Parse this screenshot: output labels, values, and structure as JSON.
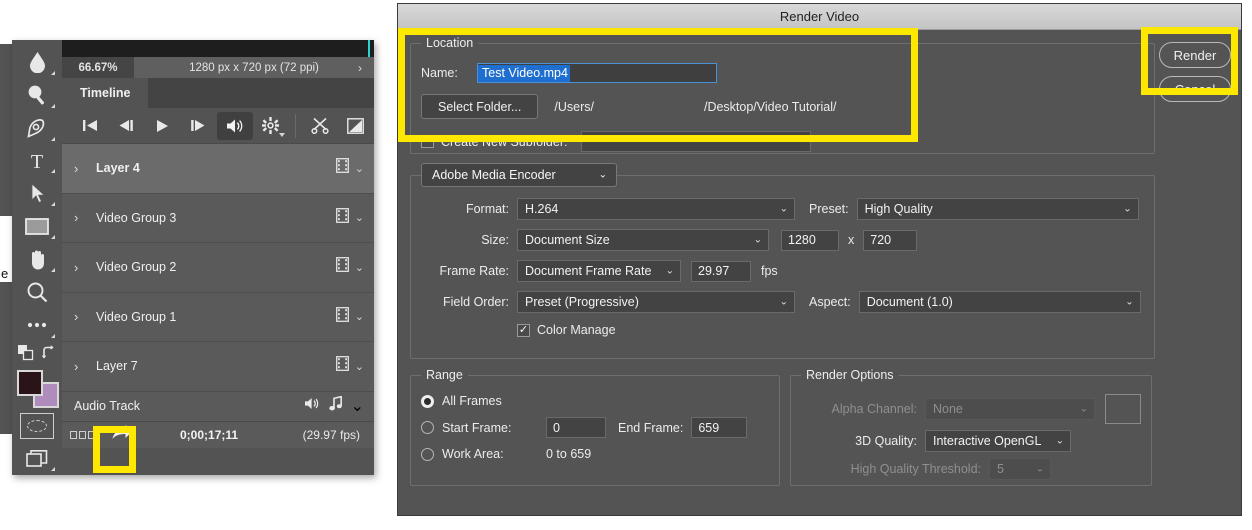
{
  "photoshop": {
    "toolbar": {
      "tools": [
        {
          "name": "blur-tool-icon",
          "label": "Blur Tool"
        },
        {
          "name": "dodge-tool-icon",
          "label": "Dodge Tool"
        },
        {
          "name": "pen-tool-icon",
          "label": "Pen Tool"
        },
        {
          "name": "type-tool-icon",
          "label": "Horizontal Type Tool"
        },
        {
          "name": "path-selection-tool-icon",
          "label": "Path Selection Tool"
        },
        {
          "name": "rectangle-tool-icon",
          "label": "Rectangle Tool"
        },
        {
          "name": "hand-tool-icon",
          "label": "Hand Tool"
        },
        {
          "name": "zoom-tool-icon",
          "label": "Zoom Tool"
        },
        {
          "name": "edit-toolbar-icon",
          "label": "Edit Toolbar"
        }
      ],
      "swap_colors_label": "Switch Foreground and Background Colors",
      "default_colors_label": "Default Foreground and Background Colors",
      "foreground_color": "#2b1418",
      "background_color": "#b08cbe",
      "quick_mask_label": "Edit in Quick Mask Mode",
      "screen_mode_label": "Change Screen Mode"
    },
    "status_bar": {
      "zoom": "66.67%",
      "doc_info": "1280 px x 720 px (72 ppi)",
      "chevron": "›"
    },
    "timeline": {
      "tab_label": "Timeline",
      "transport": [
        {
          "name": "go-to-first-frame-button",
          "label": "Go to first frame"
        },
        {
          "name": "previous-frame-button",
          "label": "Select previous frame"
        },
        {
          "name": "play-button",
          "label": "Play"
        },
        {
          "name": "next-frame-button",
          "label": "Select next frame"
        },
        {
          "name": "audio-button",
          "label": "Mute audio playback"
        },
        {
          "name": "settings-gear-button",
          "label": "Set playback options"
        },
        {
          "name": "split-clip-button",
          "label": "Split at playhead"
        },
        {
          "name": "transition-button",
          "label": "Transition"
        }
      ],
      "tracks": [
        {
          "name": "Layer 4",
          "selected": true,
          "icon": "film-strip-icon"
        },
        {
          "name": "Video Group 3",
          "selected": false,
          "icon": "film-strip-icon"
        },
        {
          "name": "Video Group 2",
          "selected": false,
          "icon": "film-strip-icon"
        },
        {
          "name": "Video Group 1",
          "selected": false,
          "icon": "film-strip-icon"
        },
        {
          "name": "Layer 7",
          "selected": false,
          "icon": "film-strip-icon"
        }
      ],
      "audio_track": {
        "label": "Audio Track",
        "speaker_icon": "speaker-icon",
        "music_icon": "music-note-icon"
      },
      "footer": {
        "timecode": "0;00;17;11",
        "fps": "(29.97 fps)",
        "render_video_label": "Render Video"
      }
    }
  },
  "dialog": {
    "title": "Render Video",
    "buttons": {
      "render": "Render",
      "cancel": "Cancel"
    },
    "location": {
      "legend": "Location",
      "name_label": "Name:",
      "name_value": "Test Video.mp4",
      "select_folder_label": "Select Folder...",
      "path_left": "/Users/",
      "path_right": "/Desktop/Video Tutorial/",
      "create_subfolder_label": "Create New Subfolder:",
      "create_subfolder_checked": false,
      "subfolder_value": ""
    },
    "encoder": {
      "engine": "Adobe Media Encoder",
      "format_label": "Format:",
      "format_value": "H.264",
      "preset_label": "Preset:",
      "preset_value": "High Quality",
      "size_label": "Size:",
      "size_value": "Document Size",
      "width": "1280",
      "times": "x",
      "height": "720",
      "frame_rate_label": "Frame Rate:",
      "frame_rate_value": "Document Frame Rate",
      "fps_value": "29.97",
      "fps_unit": "fps",
      "field_order_label": "Field Order:",
      "field_order_value": "Preset (Progressive)",
      "aspect_label": "Aspect:",
      "aspect_value": "Document (1.0)",
      "color_manage_label": "Color Manage",
      "color_manage_checked": true
    },
    "range": {
      "legend": "Range",
      "all_frames_label": "All Frames",
      "all_frames_selected": true,
      "start_frame_label": "Start Frame:",
      "start_frame_value": "0",
      "end_frame_label": "End Frame:",
      "end_frame_value": "659",
      "work_area_label": "Work Area:",
      "work_area_value": "0 to 659"
    },
    "render_options": {
      "legend": "Render Options",
      "alpha_channel_label": "Alpha Channel:",
      "alpha_channel_value": "None",
      "quality_3d_label": "3D Quality:",
      "quality_3d_value": "Interactive OpenGL",
      "hq_threshold_label": "High Quality Threshold:",
      "hq_threshold_value": "5"
    }
  },
  "annotations": {
    "highlight_color": "#ffe800",
    "boxes": [
      {
        "name": "highlight-location-group"
      },
      {
        "name": "highlight-render-button"
      },
      {
        "name": "highlight-render-video-shortcut"
      }
    ]
  }
}
